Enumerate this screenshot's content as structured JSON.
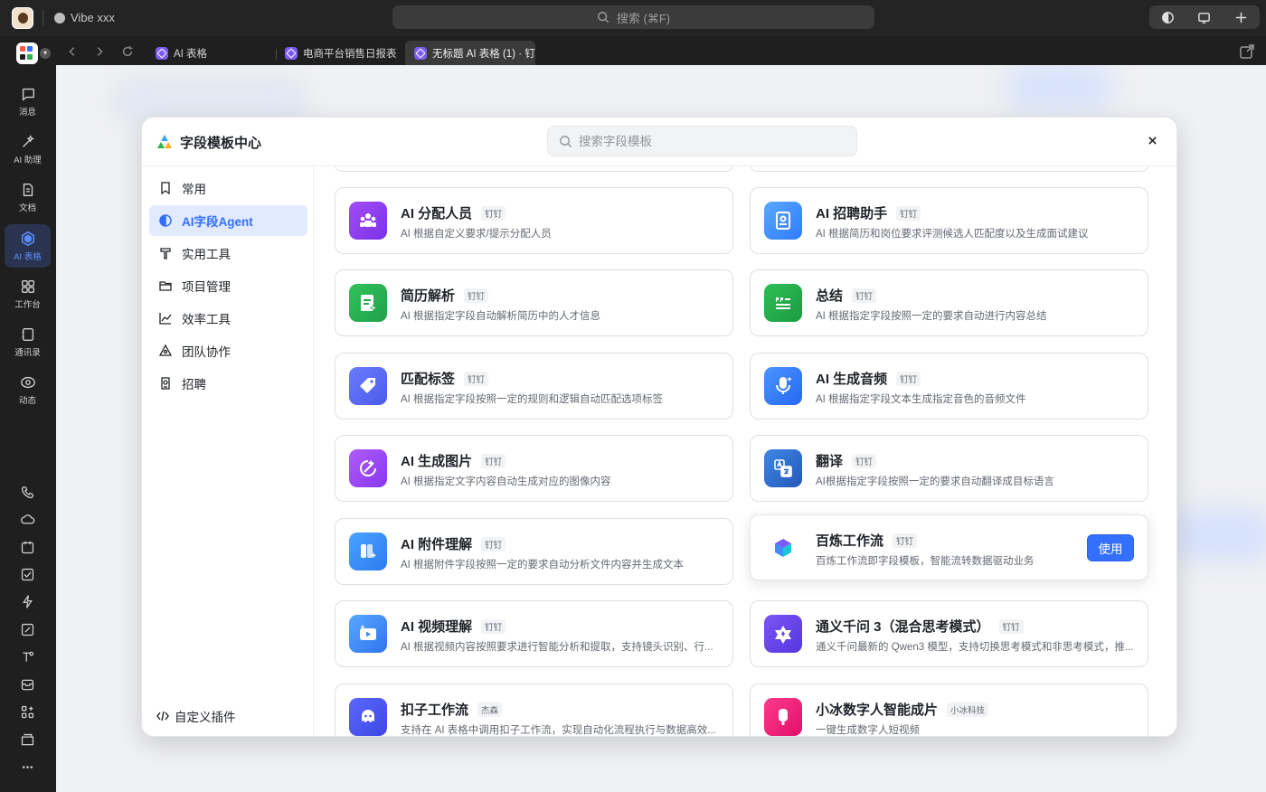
{
  "window": {
    "app_title": "Vibe xxx",
    "search_placeholder": "搜索 (⌘F)"
  },
  "tabs": [
    {
      "label": "AI 表格"
    },
    {
      "label": "电商平台销售日报表"
    },
    {
      "label": "无标题 AI 表格 (1) · 钉"
    }
  ],
  "sidebar": {
    "items": [
      {
        "label": "消息",
        "icon": "message-icon"
      },
      {
        "label": "AI 助理",
        "icon": "ai-assistant-icon"
      },
      {
        "label": "文档",
        "icon": "document-icon"
      },
      {
        "label": "AI 表格",
        "icon": "ai-table-icon",
        "active": true
      },
      {
        "label": "工作台",
        "icon": "workbench-icon"
      },
      {
        "label": "通讯录",
        "icon": "contacts-icon"
      },
      {
        "label": "动态",
        "icon": "activity-icon"
      }
    ],
    "tools": [
      "phone-icon",
      "cloud-icon",
      "calendar-icon",
      "todo-icon",
      "flash-icon",
      "note-icon",
      "text-tool-icon",
      "mail-icon",
      "apps-icon",
      "folder-icon",
      "more-icon"
    ]
  },
  "modal": {
    "title": "字段模板中心",
    "search_placeholder": "搜索字段模板",
    "categories": [
      {
        "label": "常用",
        "icon": "bookmark-icon"
      },
      {
        "label": "AI字段Agent",
        "icon": "ai-agent-icon",
        "active": true
      },
      {
        "label": "实用工具",
        "icon": "tool-icon"
      },
      {
        "label": "项目管理",
        "icon": "folder-icon"
      },
      {
        "label": "效率工具",
        "icon": "chart-icon"
      },
      {
        "label": "团队协作",
        "icon": "team-icon"
      },
      {
        "label": "招聘",
        "icon": "recruit-icon"
      }
    ],
    "custom_plugin_label": "自定义插件",
    "use_label": "使用",
    "templates": [
      {
        "title": "AI 分配人员",
        "tag": "钉钉",
        "desc": "AI 根据自定义要求/提示分配人员",
        "icon": "people-icon",
        "color": "#8b3ff0"
      },
      {
        "title": "AI 招聘助手",
        "tag": "钉钉",
        "desc": "AI 根据简历和岗位要求评测候选人匹配度以及生成面试建议",
        "icon": "badge-icon",
        "color": "#3d8bff"
      },
      {
        "title": "简历解析",
        "tag": "钉钉",
        "desc": "AI 根据指定字段自动解析简历中的人才信息",
        "icon": "resume-icon",
        "color": "#2bb24c"
      },
      {
        "title": "总结",
        "tag": "钉钉",
        "desc": "AI 根据指定字段按照一定的要求自动进行内容总结",
        "icon": "quote-icon",
        "color": "#22a84a"
      },
      {
        "title": "匹配标签",
        "tag": "钉钉",
        "desc": "AI 根据指定字段按照一定的规则和逻辑自动匹配选项标签",
        "icon": "tag-icon",
        "color": "#5b6cf5"
      },
      {
        "title": "AI 生成音频",
        "tag": "钉钉",
        "desc": "AI 根据指定字段文本生成指定音色的音频文件",
        "icon": "mic-icon",
        "color": "#2f7bff"
      },
      {
        "title": "AI 生成图片",
        "tag": "钉钉",
        "desc": "AI 根据指定文字内容自动生成对应的图像内容",
        "icon": "image-gen-icon",
        "color": "#9b4df2"
      },
      {
        "title": "翻译",
        "tag": "钉钉",
        "desc": "AI根据指定字段按照一定的要求自动翻译成目标语言",
        "icon": "translate-icon",
        "color": "#2d6fcf"
      },
      {
        "title": "AI 附件理解",
        "tag": "钉钉",
        "desc": "AI 根据附件字段按照一定的要求自动分析文件内容并生成文本",
        "icon": "attachment-icon",
        "color": "#2f8cff"
      },
      {
        "title": "百炼工作流",
        "tag": "钉钉",
        "desc": "百炼工作流即字段模板，智能流转数据驱动业务",
        "icon": "bailian-icon",
        "color": "#ffffff",
        "hovered": true
      },
      {
        "title": "AI 视频理解",
        "tag": "钉钉",
        "desc": "AI 根据视频内容按照要求进行智能分析和提取，支持镜头识别、行...",
        "icon": "video-icon",
        "color": "#3b8cff"
      },
      {
        "title": "通义千问 3（混合思考模式）",
        "tag": "钉钉",
        "desc": "通义千问最新的 Qwen3 模型，支持切换思考模式和非思考模式，推...",
        "icon": "qwen-icon",
        "color": "#6a45f0"
      },
      {
        "title": "扣子工作流",
        "tag": "杰森",
        "desc": "支持在 AI 表格中调用扣子工作流，实现自动化流程执行与数据高效...",
        "icon": "coze-icon",
        "color": "#4a57ee"
      },
      {
        "title": "小冰数字人智能成片",
        "tag": "小冰科技",
        "desc": "一键生成数字人短视频",
        "icon": "xiaobing-icon",
        "color": "#f0217a"
      }
    ]
  }
}
